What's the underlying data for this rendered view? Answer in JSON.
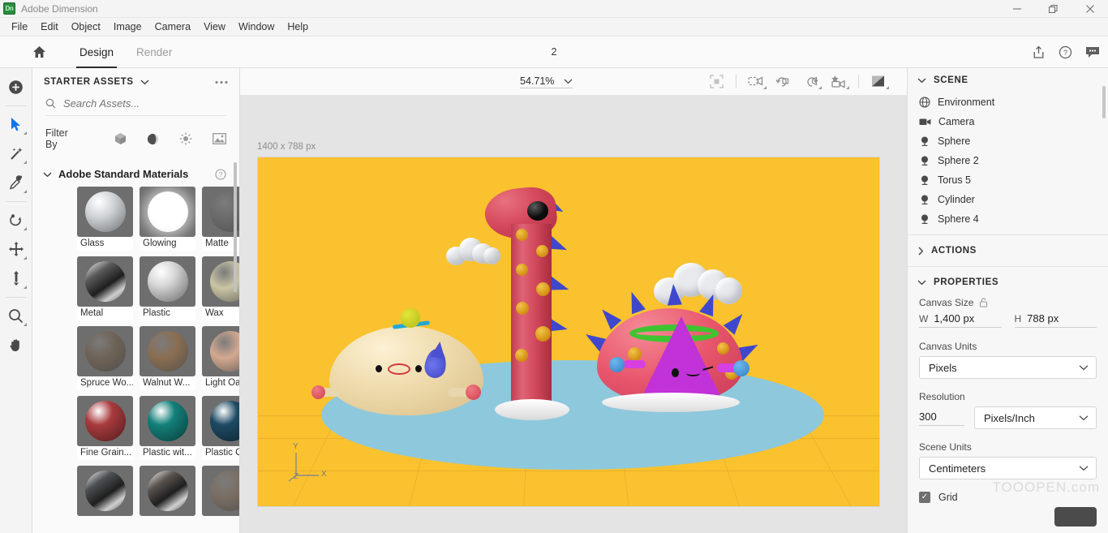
{
  "titlebar": {
    "logo_text": "Dn",
    "app_title": "Adobe Dimension",
    "minimize": "—",
    "maximize": "❐",
    "close": "✕"
  },
  "menubar": {
    "items": [
      "File",
      "Edit",
      "Object",
      "Image",
      "Camera",
      "View",
      "Window",
      "Help"
    ]
  },
  "modebar": {
    "home_icon": "home-icon",
    "tabs": [
      {
        "label": "Design",
        "active": true
      },
      {
        "label": "Render",
        "active": false
      }
    ],
    "document_label": "2",
    "share_icon": "share-icon",
    "help_icon": "help-icon",
    "comment_icon": "comment-icon"
  },
  "toolrail": {
    "tools": [
      {
        "name": "add-content-tool",
        "icon": "plus-circle-icon",
        "has_flyout": false,
        "active": false
      },
      {
        "name": "select-tool",
        "icon": "cursor-arrow-icon",
        "has_flyout": true,
        "active": true
      },
      {
        "name": "magic-wand-tool",
        "icon": "magic-wand-icon",
        "has_flyout": true,
        "active": false
      },
      {
        "name": "sampler-tool",
        "icon": "eyedropper-icon",
        "has_flyout": true,
        "active": false
      },
      {
        "name": "orbit-tool",
        "icon": "orbit-icon",
        "has_flyout": true,
        "active": false
      },
      {
        "name": "move-tool",
        "icon": "move-arrows-icon",
        "has_flyout": true,
        "active": false
      },
      {
        "name": "scale-tool",
        "icon": "scale-vertical-icon",
        "has_flyout": true,
        "active": false
      },
      {
        "name": "zoom-tool",
        "icon": "magnifier-icon",
        "has_flyout": true,
        "active": false
      },
      {
        "name": "pan-tool",
        "icon": "hand-icon",
        "has_flyout": false,
        "active": false
      }
    ]
  },
  "assets": {
    "panel_title": "STARTER ASSETS",
    "panel_chevron": "chevron-down-icon",
    "overflow_icon": "more-options-icon",
    "search": {
      "placeholder": "Search Assets...",
      "value": "",
      "icon": "search-icon"
    },
    "filter_label": "Filter By",
    "filter_icons": [
      "cube-model-icon",
      "material-sphere-icon",
      "light-sun-icon",
      "image-icon"
    ],
    "section": {
      "title": "Adobe Standard Materials",
      "chevron": "chevron-down-icon",
      "help_icon": "help-circle-icon"
    },
    "materials": [
      {
        "name": "Glass",
        "color": "#cfd3d6",
        "style": "glass"
      },
      {
        "name": "Glowing",
        "color": "#ffffff",
        "style": "glow"
      },
      {
        "name": "Matte",
        "color": "#6b6b6b",
        "style": "matte"
      },
      {
        "name": "Metal",
        "color": "#5a5a5a",
        "style": "metal"
      },
      {
        "name": "Plastic",
        "color": "#d8d8d8",
        "style": "plastic"
      },
      {
        "name": "Wax",
        "color": "#c9c5a4",
        "style": "matte"
      },
      {
        "name": "Spruce Wo...",
        "color": "#6f6357",
        "style": "matte"
      },
      {
        "name": "Walnut W...",
        "color": "#8a6e52",
        "style": "matte"
      },
      {
        "name": "Light Oak ...",
        "color": "#d4a890",
        "style": "matte"
      },
      {
        "name": "Fine Grain...",
        "color": "#a93b3e",
        "style": "plastic"
      },
      {
        "name": "Plastic wit...",
        "color": "#13807a",
        "style": "plastic"
      },
      {
        "name": "Plastic Can...",
        "color": "#1d4a63",
        "style": "plastic"
      },
      {
        "name": "",
        "color": "#4d5154",
        "style": "metal"
      },
      {
        "name": "",
        "color": "#5b5450",
        "style": "metal"
      },
      {
        "name": "",
        "color": "#7a6e63",
        "style": "matte"
      }
    ]
  },
  "canvas": {
    "zoom_level": "54.71%",
    "zoom_chevron": "chevron-down-icon",
    "toolbar_icons": [
      "fit-selection-icon",
      "camera-bookmark-icon",
      "camera-undo-icon",
      "camera-redo-icon",
      "camera-star-icon",
      "render-preview-icon"
    ],
    "dimensions_label": "1400 x 788 px",
    "background_color": "#f9c22e",
    "ground_color": "#8ec8dd",
    "axis_labels": {
      "x": "X",
      "y": "Y",
      "z": "Z"
    }
  },
  "scene_panel": {
    "title": "SCENE",
    "chevron": "chevron-down-icon",
    "items": [
      {
        "label": "Environment",
        "icon": "environment-globe-icon"
      },
      {
        "label": "Camera",
        "icon": "camera-icon"
      },
      {
        "label": "Sphere",
        "icon": "object-sphere-icon"
      },
      {
        "label": "Sphere 2",
        "icon": "object-sphere-icon"
      },
      {
        "label": "Torus 5",
        "icon": "object-sphere-icon"
      },
      {
        "label": "Cylinder",
        "icon": "object-sphere-icon"
      },
      {
        "label": "Sphere 4",
        "icon": "object-sphere-icon"
      }
    ]
  },
  "actions_panel": {
    "title": "ACTIONS",
    "chevron": "chevron-right-icon"
  },
  "properties": {
    "title": "PROPERTIES",
    "chevron": "chevron-down-icon",
    "canvas_size_label": "Canvas Size",
    "lock_icon": "unlock-icon",
    "width_key": "W",
    "width_value": "1,400 px",
    "height_key": "H",
    "height_value": "788 px",
    "canvas_units_label": "Canvas Units",
    "canvas_units_value": "Pixels",
    "resolution_label": "Resolution",
    "resolution_value": "300",
    "resolution_units_value": "Pixels/Inch",
    "scene_units_label": "Scene Units",
    "scene_units_value": "Centimeters",
    "grid_label": "Grid",
    "grid_checked": true
  },
  "watermark": {
    "text": "TOOOPEN.com"
  }
}
